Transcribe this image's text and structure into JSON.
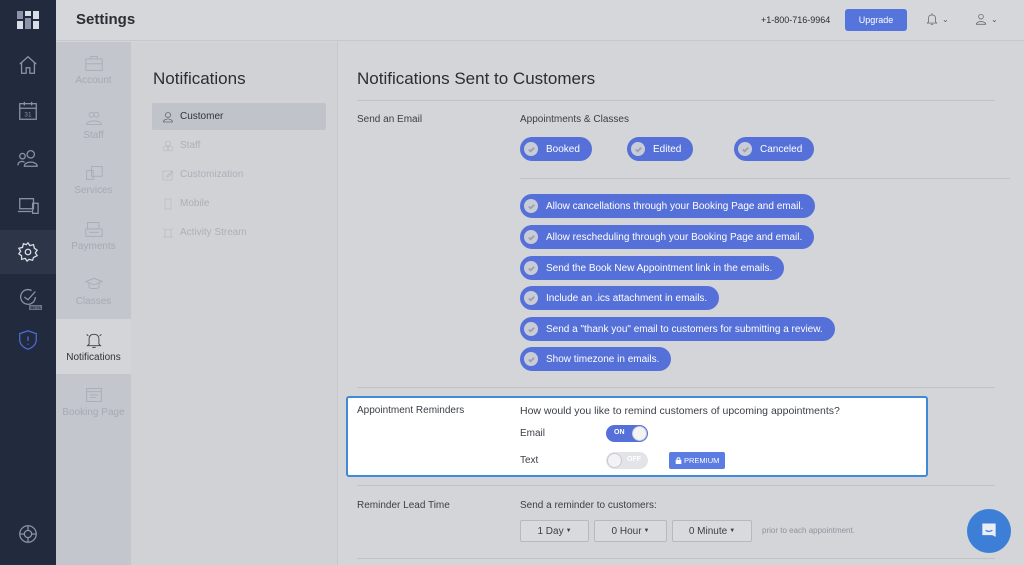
{
  "header": {
    "title": "Settings",
    "phone": "+1-800-716-9964",
    "upgrade_label": "Upgrade",
    "notifications_icon": "bell-icon",
    "user_icon": "user-icon"
  },
  "rail": {
    "items": [
      {
        "name": "home",
        "icon": "home-icon"
      },
      {
        "name": "calendar",
        "icon": "calendar-icon",
        "text": "31"
      },
      {
        "name": "customers",
        "icon": "users-icon"
      },
      {
        "name": "devices",
        "icon": "devices-icon"
      },
      {
        "name": "settings",
        "icon": "gear-icon",
        "active": true
      },
      {
        "name": "tasks",
        "icon": "check-circle-icon",
        "badge": "BETA"
      },
      {
        "name": "security",
        "icon": "shield-icon"
      },
      {
        "name": "help",
        "icon": "lifebuoy-icon"
      }
    ]
  },
  "categories": [
    {
      "label": "Account",
      "icon": "briefcase-icon"
    },
    {
      "label": "Staff",
      "icon": "staff-icon"
    },
    {
      "label": "Services",
      "icon": "services-icon"
    },
    {
      "label": "Payments",
      "icon": "register-icon"
    },
    {
      "label": "Classes",
      "icon": "graduation-cap-icon"
    },
    {
      "label": "Notifications",
      "icon": "bell-icon",
      "active": true
    },
    {
      "label": "Booking Page",
      "icon": "booking-page-icon"
    }
  ],
  "subnav": {
    "title": "Notifications",
    "items": [
      {
        "label": "Customer",
        "icon": "user-icon",
        "active": true
      },
      {
        "label": "Staff",
        "icon": "staff-icon"
      },
      {
        "label": "Customization",
        "icon": "edit-icon"
      },
      {
        "label": "Mobile",
        "icon": "mobile-icon"
      },
      {
        "label": "Activity Stream",
        "icon": "activity-icon"
      }
    ]
  },
  "main": {
    "title": "Notifications Sent to Customers",
    "send_email": {
      "label": "Send an Email",
      "group_label": "Appointments & Classes",
      "events": [
        "Booked",
        "Edited",
        "Canceled"
      ],
      "options": [
        "Allow cancellations through your Booking Page and email.",
        "Allow rescheduling through your Booking Page and email.",
        "Send the Book New Appointment link in the emails.",
        "Include an .ics attachment in emails.",
        "Send a \"thank you\" email to customers for submitting a review.",
        "Show timezone in emails."
      ]
    },
    "reminders": {
      "label": "Appointment Reminders",
      "question": "How would you like to remind customers of upcoming appointments?",
      "email_label": "Email",
      "email_toggle": "ON",
      "text_label": "Text",
      "text_toggle": "OFF",
      "premium_label": "PREMIUM"
    },
    "lead_time": {
      "label": "Reminder Lead Time",
      "prompt": "Send a reminder to customers:",
      "day": "1 Day",
      "hour": "0 Hour",
      "minute": "0 Minute",
      "suffix": "prior to each appointment."
    }
  },
  "colors": {
    "accent": "#5570d8",
    "rail_bg": "#222a3d",
    "highlight_border": "#3f8ad8",
    "chat_button": "#3d7fd6"
  }
}
